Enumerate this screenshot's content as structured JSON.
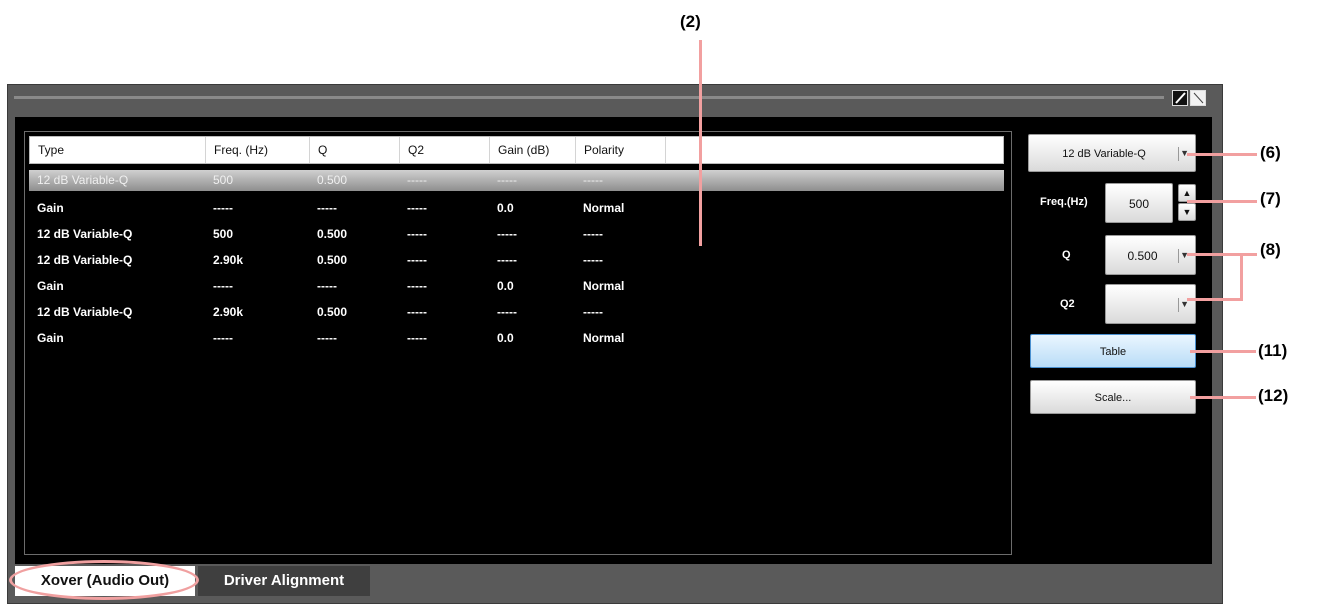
{
  "table": {
    "headers": [
      "Type",
      "Freq. (Hz)",
      "Q",
      "Q2",
      "Gain (dB)",
      "Polarity"
    ],
    "rows": [
      [
        "12 dB Variable-Q",
        "500",
        "0.500",
        "-----",
        "-----",
        "-----"
      ],
      [
        "Gain",
        "-----",
        "-----",
        "-----",
        "0.0",
        "Normal"
      ],
      [
        "12 dB Variable-Q",
        "500",
        "0.500",
        "-----",
        "-----",
        "-----"
      ],
      [
        "12 dB Variable-Q",
        "2.90k",
        "0.500",
        "-----",
        "-----",
        "-----"
      ],
      [
        "Gain",
        "-----",
        "-----",
        "-----",
        "0.0",
        "Normal"
      ],
      [
        "12 dB Variable-Q",
        "2.90k",
        "0.500",
        "-----",
        "-----",
        "-----"
      ],
      [
        "Gain",
        "-----",
        "-----",
        "-----",
        "0.0",
        "Normal"
      ]
    ],
    "selected_row": 0
  },
  "controls": {
    "type_value": "12 dB Variable-Q",
    "freq_label": "Freq.(Hz)",
    "freq_value": "500",
    "q_label": "Q",
    "q_value": "0.500",
    "q2_label": "Q2",
    "q2_value": "",
    "table_button": "Table",
    "scale_button": "Scale..."
  },
  "tabs": [
    "Xover (Audio Out)",
    "Driver Alignment"
  ],
  "callouts": {
    "c2": "(2)",
    "c6": "(6)",
    "c7": "(7)",
    "c8": "(8)",
    "c11": "(11)",
    "c12": "(12)"
  },
  "colors": {
    "callout_line": "#f2a0a0",
    "panel_bg": "#000000",
    "frame": "#5a5a5a"
  },
  "icons": [
    "pen-icon",
    "eraser-icon",
    "dropdown-arrow-icon",
    "spin-up-icon",
    "spin-down-icon"
  ]
}
